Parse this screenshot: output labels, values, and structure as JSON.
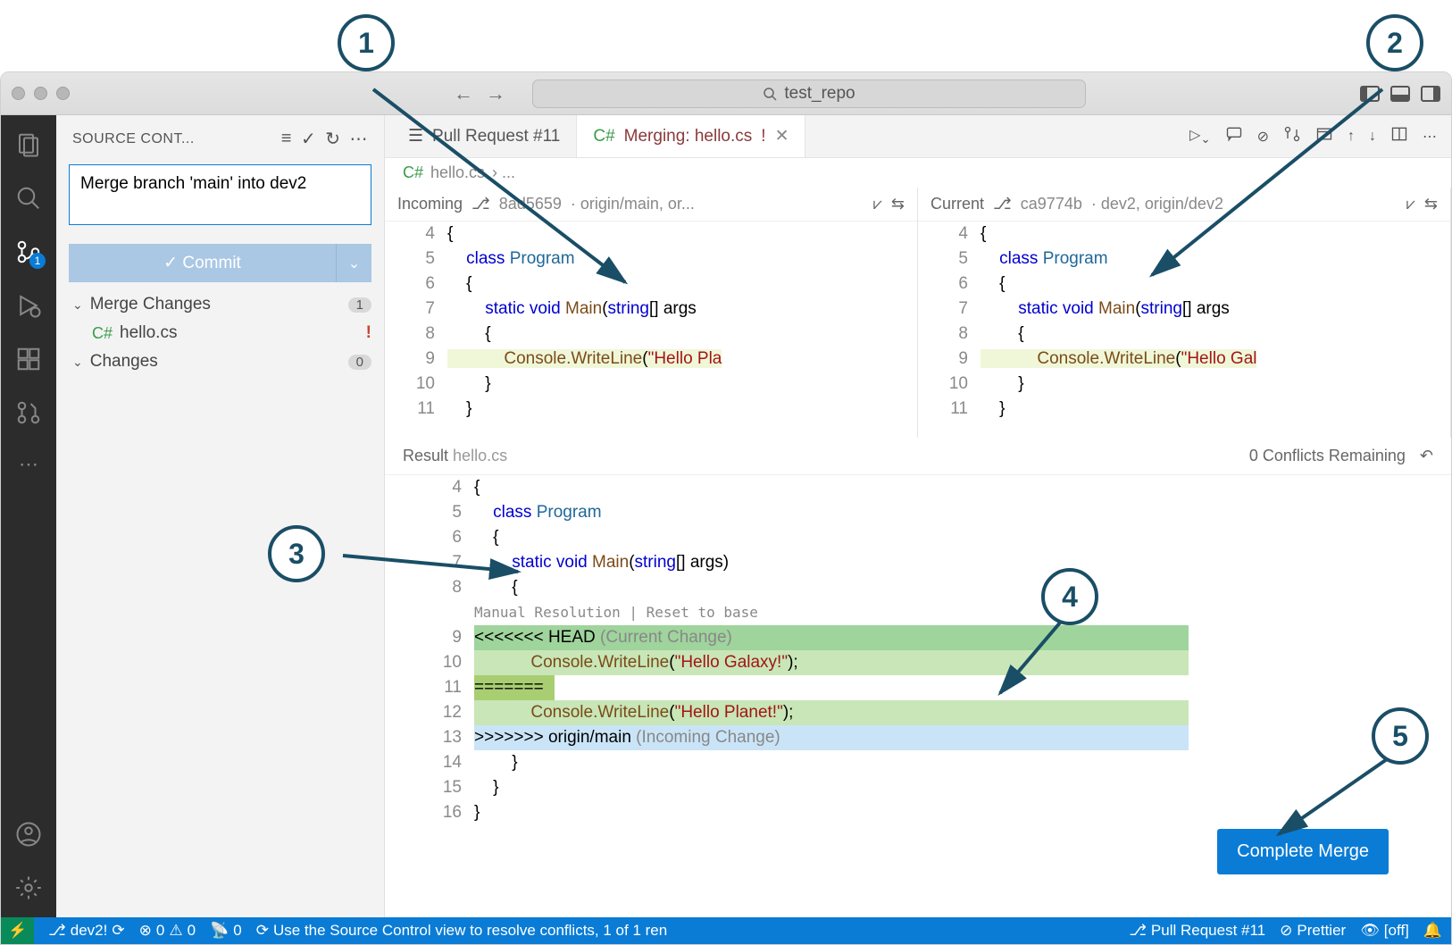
{
  "annotations": [
    "1",
    "2",
    "3",
    "4",
    "5"
  ],
  "titlebar": {
    "search_placeholder": "test_repo"
  },
  "activity": {
    "scm_badge": "1"
  },
  "sidebar": {
    "title": "SOURCE CONT...",
    "commit_message": "Merge branch 'main' into dev2",
    "commit_button": "Commit",
    "sections": {
      "merge_changes": {
        "label": "Merge Changes",
        "count": "1"
      },
      "changes": {
        "label": "Changes",
        "count": "0"
      }
    },
    "files": {
      "hello": {
        "name": "hello.cs",
        "status": "!"
      }
    }
  },
  "tabs": {
    "pr": {
      "label": "Pull Request #11"
    },
    "merge": {
      "label": "Merging: hello.cs",
      "dirty": "!"
    }
  },
  "breadcrumb": {
    "file": "hello.cs",
    "rest": "› ..."
  },
  "incoming": {
    "title": "Incoming",
    "commit": "8ad5659",
    "ref": "origin/main, or...",
    "lines": [
      "4",
      "5",
      "6",
      "7",
      "8",
      "9",
      "10",
      "11"
    ],
    "row4": "{",
    "row5_kw": "class",
    "row5_name": " Program",
    "row6": "{",
    "row7_kw1": "static",
    "row7_kw2": " void",
    "row7_fn": " Main",
    "row7_p1": "(",
    "row7_t": "string",
    "row7_p2": "[] args",
    "row8": "{",
    "row9_fn": "Console.WriteLine",
    "row9_p1": "(",
    "row9_str": "\"Hello Pla",
    "row10": "}",
    "row11": "}"
  },
  "current": {
    "title": "Current",
    "commit": "ca9774b",
    "ref": "dev2, origin/dev2",
    "lines": [
      "4",
      "5",
      "6",
      "7",
      "8",
      "9",
      "10",
      "11"
    ],
    "row4": "{",
    "row5_kw": "class",
    "row5_name": " Program",
    "row6": "{",
    "row7_kw1": "static",
    "row7_kw2": " void",
    "row7_fn": " Main",
    "row7_p1": "(",
    "row7_t": "string",
    "row7_p2": "[] args",
    "row8": "{",
    "row9_fn": "Console.WriteLine",
    "row9_p1": "(",
    "row9_str": "\"Hello Gal",
    "row10": "}",
    "row11": "}"
  },
  "result": {
    "title": "Result",
    "file": "hello.cs",
    "conflicts": "0 Conflicts Remaining",
    "lens": "Manual Resolution | Reset to base",
    "lines": [
      "4",
      "5",
      "6",
      "7",
      "8",
      "9",
      "10",
      "11",
      "12",
      "13",
      "14",
      "15",
      "16"
    ],
    "row4": "{",
    "row5_kw": "class",
    "row5_name": " Program",
    "row6": "{",
    "row7_kw1": "static",
    "row7_kw2": " void",
    "row7_fn": " Main",
    "row7_p1": "(",
    "row7_t": "string",
    "row7_rest": "[] args)",
    "row8": "{",
    "row9_marker": "<<<<<<< HEAD ",
    "row9_label": "(Current Change)",
    "row10_fn": "Console.WriteLine",
    "row10_p1": "(",
    "row10_str": "\"Hello Galaxy!\"",
    "row10_end": ");",
    "row11": "=======",
    "row12_fn": "Console.WriteLine",
    "row12_p1": "(",
    "row12_str": "\"Hello Planet!\"",
    "row12_end": ");",
    "row13_marker": ">>>>>>> origin/main ",
    "row13_label": "(Incoming Change)",
    "row14": "}",
    "row15": "}",
    "row16": "}",
    "complete_button": "Complete Merge"
  },
  "status": {
    "branch": "dev2!",
    "errors": "0",
    "warnings": "0",
    "ports": "0",
    "sync": "Use the Source Control view to resolve conflicts, 1 of 1 ren",
    "pr": "Pull Request #11",
    "prettier": "Prettier",
    "off": "[off]"
  }
}
